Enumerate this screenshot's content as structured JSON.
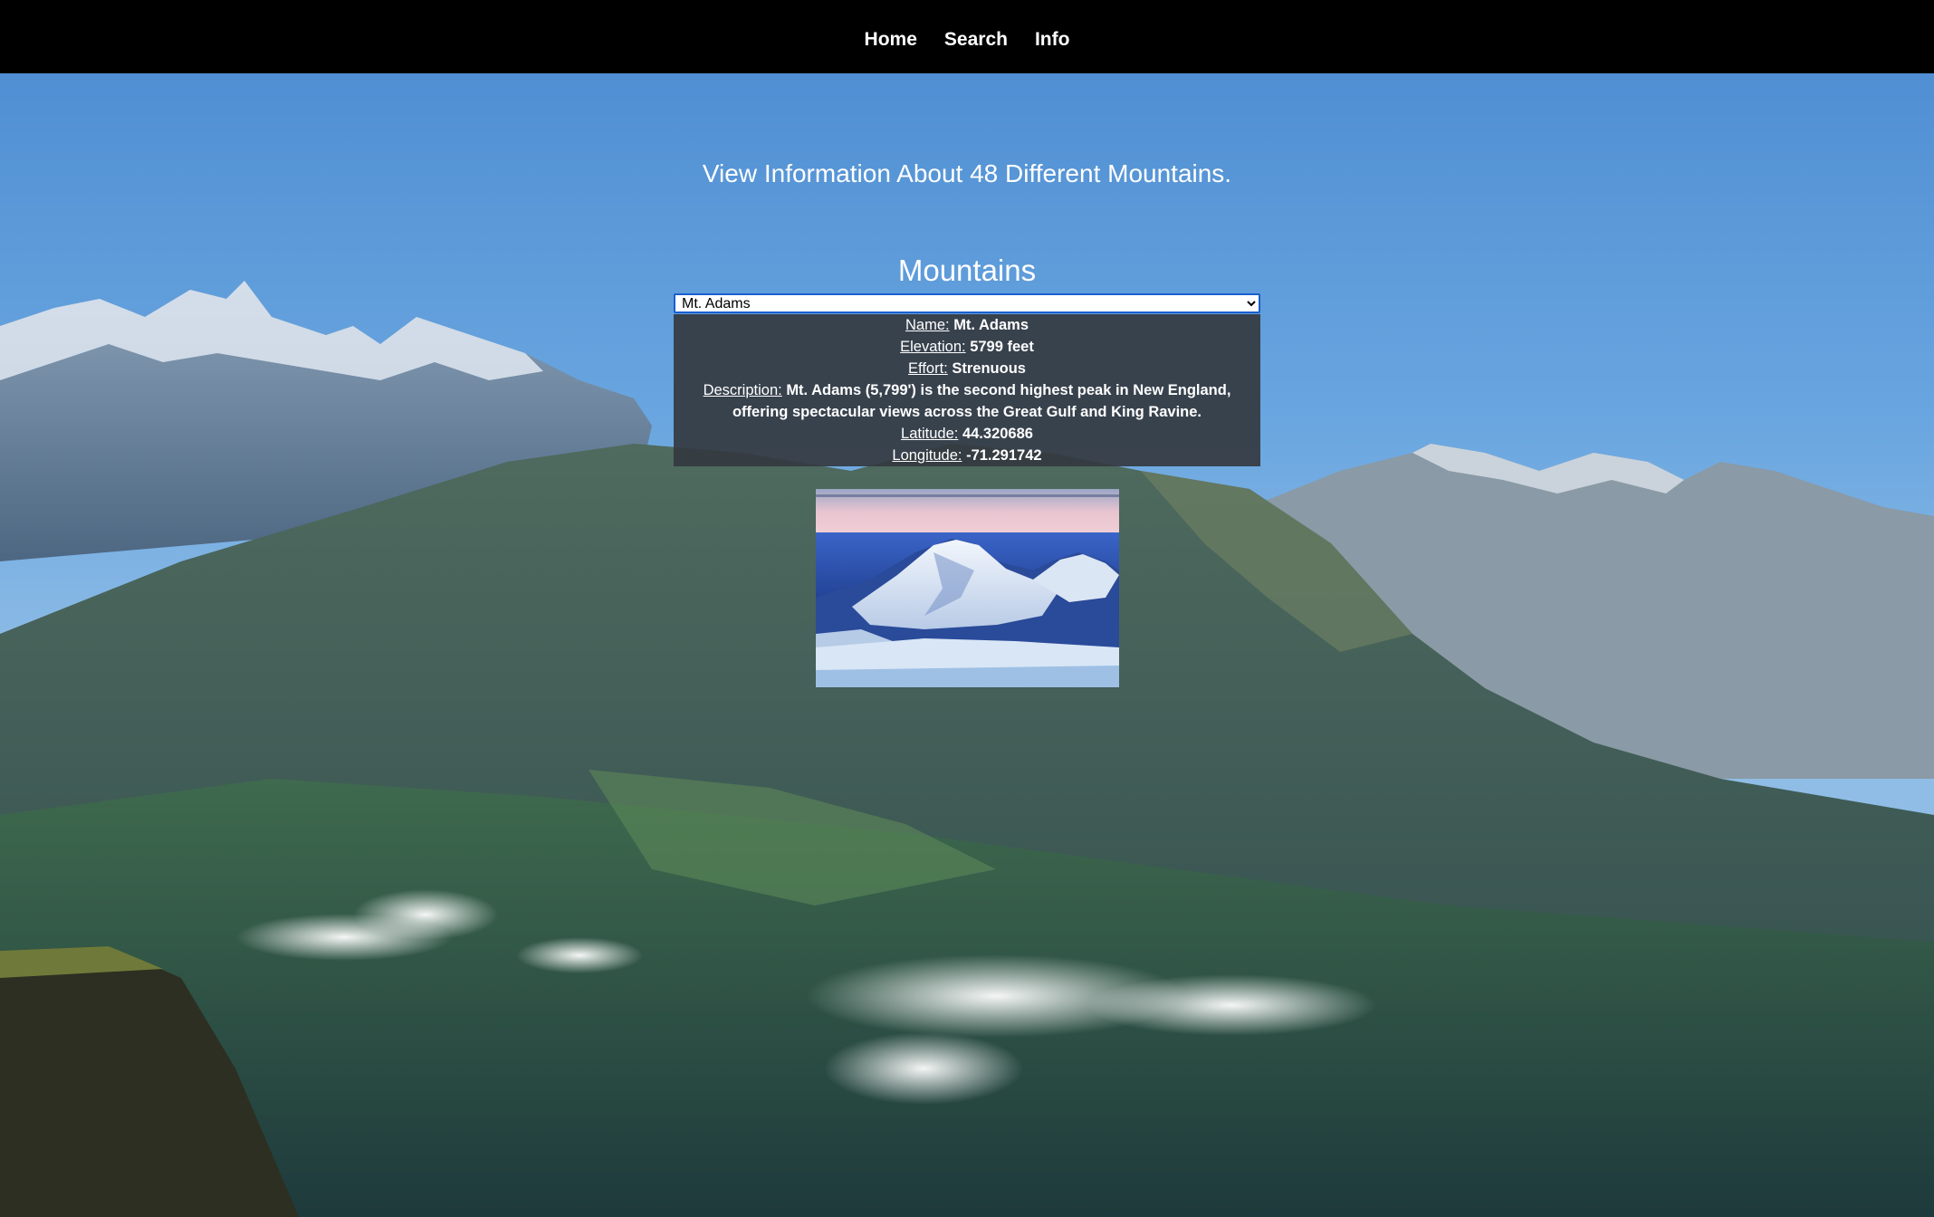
{
  "nav": {
    "home": "Home",
    "search": "Search",
    "info": "Info"
  },
  "headline": "View Information About 48 Different Mountains.",
  "section_title": "Mountains",
  "mountain_select": {
    "selected": "Mt. Adams"
  },
  "details": {
    "name_label": "Name:",
    "name": "Mt. Adams",
    "elevation_label": "Elevation:",
    "elevation": "5799 feet",
    "effort_label": "Effort:",
    "effort": "Strenuous",
    "description_label": "Description:",
    "description": "Mt. Adams (5,799') is the second highest peak in New England, offering spectacular views across the Great Gulf and King Ravine.",
    "latitude_label": "Latitude:",
    "latitude": "44.320686",
    "longitude_label": "Longitude:",
    "longitude": "-71.291742"
  },
  "colors": {
    "navbar": "#000000",
    "info_box": "#343a40",
    "select_border": "#1a5fd0"
  }
}
